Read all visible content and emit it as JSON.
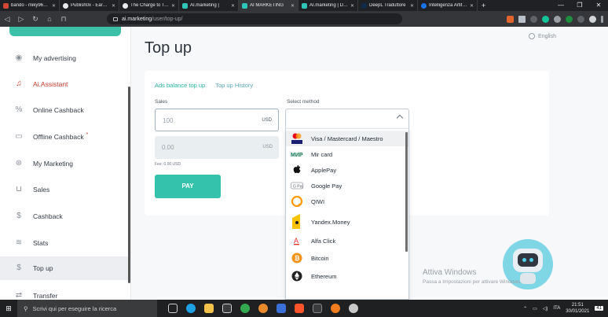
{
  "browser": {
    "tabs": [
      {
        "label": "bando - miky96123@",
        "color": "#d14836"
      },
      {
        "label": "Publish0x - Earn Cry",
        "color": "#e8eaed"
      },
      {
        "label": "The Charge to Tethe",
        "color": "#e8eaed"
      },
      {
        "label": "AI.marketing |",
        "color": "#2ec4b6"
      },
      {
        "label": "AI MARKETING",
        "color": "#2ec4b6",
        "active": true
      },
      {
        "label": "AI.marketing | Dom",
        "color": "#2ec4b6"
      },
      {
        "label": "DeepL Traduttore",
        "color": "#0f2b46"
      },
      {
        "label": "Intelligenza Artificia",
        "color": "#1a73e8"
      }
    ],
    "new_tab_label": "+",
    "url_host": "ai.marketing",
    "url_path": "/user/top-up/"
  },
  "sidebar": {
    "items": [
      {
        "label": "My advertising",
        "icon": "user-circle-icon"
      },
      {
        "label": "Ai.Assistant",
        "icon": "assistant-icon"
      },
      {
        "label": "Online Cashback",
        "icon": "percent-icon"
      },
      {
        "label": "Offline Cashback",
        "icon": "shopping-bag-icon",
        "badge": "*"
      },
      {
        "label": "My Marketing",
        "icon": "network-icon"
      },
      {
        "label": "Sales",
        "icon": "cart-icon"
      },
      {
        "label": "Cashback",
        "icon": "dollar-coin-icon"
      },
      {
        "label": "Stats",
        "icon": "stats-icon"
      },
      {
        "label": "Top up",
        "icon": "dollar-icon",
        "active": true
      },
      {
        "label": "Transfer",
        "icon": "transfer-icon"
      }
    ]
  },
  "header": {
    "language": "English",
    "title": "Top up"
  },
  "form": {
    "tab_balance": "Ads balance top up",
    "tab_history": "Top up History",
    "sales_label": "Sales",
    "sales_placeholder": "100",
    "sales_currency": "USD",
    "converted_value": "0.00",
    "converted_currency": "USD",
    "fee_text": "Fee: 0.00 USD",
    "pay_label": "PAY",
    "method_label": "Select method",
    "methods": [
      {
        "label": "Visa / Mastercard / Maestro",
        "icon": "visa-mastercard-icon",
        "selected": true
      },
      {
        "label": "Mir card",
        "icon": "mir-icon"
      },
      {
        "label": "ApplePay",
        "icon": "apple-icon"
      },
      {
        "label": "Google Pay",
        "icon": "google-pay-icon"
      },
      {
        "label": "QIWI",
        "icon": "qiwi-icon"
      },
      {
        "label": "Yandex.Money",
        "icon": "yandex-money-icon"
      },
      {
        "label": "Alfa Click",
        "icon": "alfa-icon"
      },
      {
        "label": "Bitcoin",
        "icon": "bitcoin-icon"
      },
      {
        "label": "Ethereum",
        "icon": "ethereum-icon"
      }
    ]
  },
  "watermark": {
    "line1": "Attiva Windows",
    "line2": "Passa a Impostazioni per attivare Windows."
  },
  "taskbar": {
    "search_placeholder": "Scrivi qui per eseguire la ricerca",
    "language": "ITA",
    "time": "21:51",
    "date": "30/01/2021",
    "notifications": "41"
  },
  "colors": {
    "accent": "#35c2ad",
    "accent_tab": "#23b39c"
  }
}
